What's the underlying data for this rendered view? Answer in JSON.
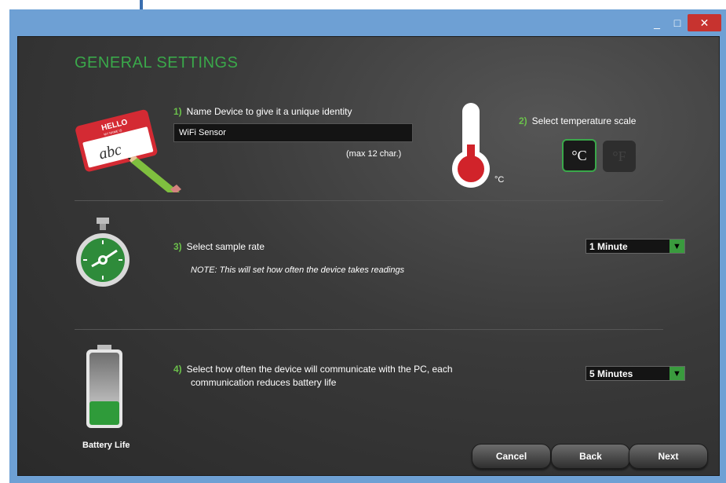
{
  "window": {
    "minimize_icon": "minimize-icon",
    "maximize_icon": "maximize-icon",
    "close_icon": "close-icon",
    "minimize_glyph": "_",
    "maximize_glyph": "□",
    "close_glyph": "✕"
  },
  "page": {
    "title": "GENERAL SETTINGS"
  },
  "section1": {
    "step": "1)",
    "label": "Name Device to give it a unique identity",
    "input_value": "WiFi Sensor",
    "hint": "(max 12 char.)",
    "icon": "name-tag-icon",
    "tag_hello": "HELLO",
    "tag_sub": "MY NAME IS",
    "tag_text": "abc"
  },
  "section2": {
    "step": "2)",
    "label": "Select temperature scale",
    "unit_label": "°C",
    "icon": "thermometer-icon",
    "celsius": "°C",
    "fahrenheit": "°F",
    "selected": "°C"
  },
  "section3": {
    "step": "3)",
    "label": "Select sample rate",
    "note": "NOTE: This will set how often the device takes readings",
    "selected": "1 Minute",
    "icon": "stopwatch-icon"
  },
  "section4": {
    "step": "4)",
    "label_line1": "Select how often the device will communicate with the PC, each",
    "label_line2": "communication reduces battery life",
    "selected": "5 Minutes",
    "icon": "battery-icon",
    "battery_label": "Battery Life"
  },
  "footer": {
    "cancel": "Cancel",
    "back": "Back",
    "next": "Next"
  },
  "colors": {
    "accent_green": "#3aa84a",
    "window_blue": "#6ea0d4",
    "close_red": "#c7332f"
  }
}
